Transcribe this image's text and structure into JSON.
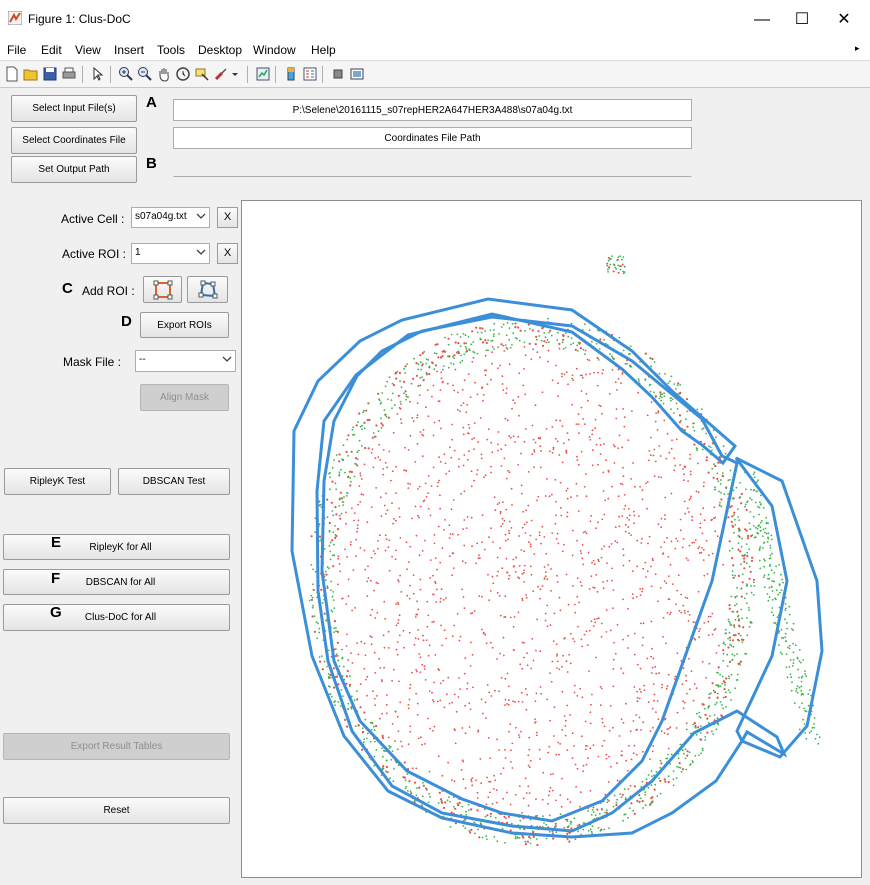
{
  "window": {
    "title": "Figure 1: Clus-DoC",
    "minimize": "—",
    "maximize": "☐",
    "close": "✕"
  },
  "menu": [
    "File",
    "Edit",
    "View",
    "Insert",
    "Tools",
    "Desktop",
    "Window",
    "Help"
  ],
  "menu_overflow": "▸",
  "buttons": {
    "select_input": "Select Input File(s)",
    "select_coords": "Select Coordinates File",
    "set_output": "Set Output Path",
    "export_rois": "Export ROIs",
    "align_mask": "Align Mask",
    "ripleyk_test": "RipleyK Test",
    "dbscan_test": "DBSCAN Test",
    "ripleyk_all": "RipleyK for All",
    "dbscan_all": "DBSCAN for All",
    "clusdoc_all": "Clus-DoC for All",
    "export_results": "Export Result Tables",
    "reset": "Reset"
  },
  "fields": {
    "input_path": "P:\\Selene\\20161115_s07repHER2A647HER3A488\\s07a04g.txt",
    "coords_path": "Coordinates File Path",
    "output_path": ""
  },
  "labels": {
    "active_cell": "Active Cell :",
    "active_roi": "Active ROI :",
    "add_roi": "Add ROI :",
    "mask_file": "Mask File :"
  },
  "combos": {
    "active_cell": "s07a04g.txt",
    "active_roi": "1",
    "mask_file": "--"
  },
  "clear_symbol": "X",
  "markers": {
    "a": "A",
    "b": "B",
    "c": "C",
    "d": "D",
    "e": "E",
    "f": "F",
    "g": "G"
  },
  "colors": {
    "roi_outline": "#3b8fd8",
    "channel_red": "#e8504a",
    "channel_green": "#3cb34a",
    "roi_button_accent": "#d9642a"
  }
}
